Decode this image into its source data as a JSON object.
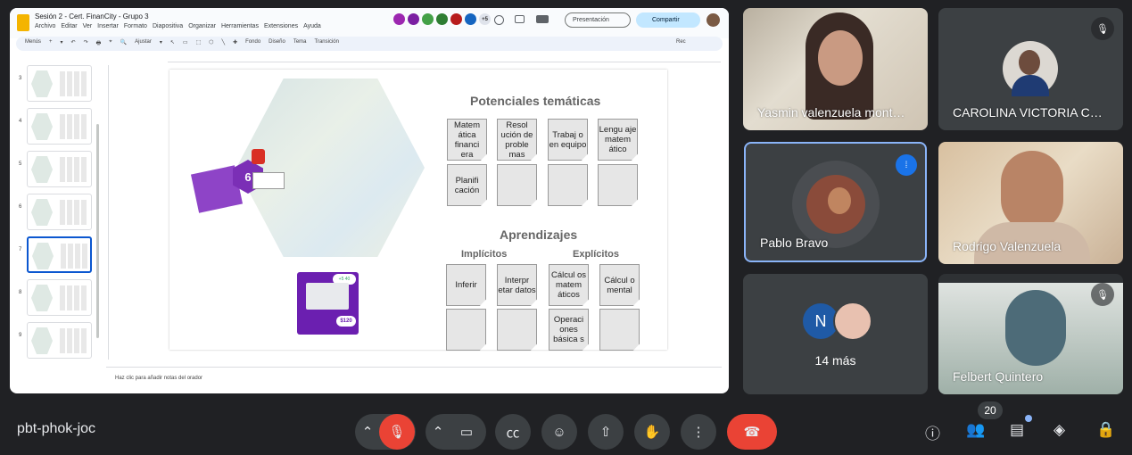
{
  "doc": {
    "title": "Sesión 2 - Cert. FinanCity - Grupo 3",
    "menu": [
      "Archivo",
      "Editar",
      "Ver",
      "Insertar",
      "Formato",
      "Diapositiva",
      "Organizar",
      "Herramientas",
      "Extensiones",
      "Ayuda"
    ],
    "collab_more": "+5",
    "present_label": "Presentación",
    "share_label": "Compartir",
    "toolbar": [
      "Menús",
      "+",
      "▾",
      "↶",
      "↷",
      "🖶",
      "⌖",
      "🔍",
      "Ajustar",
      "▾",
      "↖",
      "▭",
      "⬚",
      "⬡",
      "╲",
      "✚",
      "Fondo",
      "Diseño",
      "Tema",
      "Transición"
    ],
    "rec_label": "Rec",
    "notes_placeholder": "Haz clic para añadir notas del orador"
  },
  "thumbs": [
    "3",
    "4",
    "5",
    "6",
    "7",
    "8",
    "9"
  ],
  "slide": {
    "title1": "Potenciales temáticas",
    "row1": [
      "Matem ática financi era",
      "Resol ución de proble mas",
      "Trabaj o en equipo",
      "Lengu aje matem ático"
    ],
    "row2": [
      "Planifi cación",
      "",
      "",
      ""
    ],
    "title2": "Aprendizajes",
    "sub_left": "Implícitos",
    "sub_right": "Explícitos",
    "row3": [
      "Inferir",
      "Interpr etar datos",
      "Cálcul os matem áticos",
      "Cálcul o mental"
    ],
    "row4": [
      "",
      "",
      "Operaci ones básica s",
      ""
    ],
    "hex_number": "6",
    "card_price": "$120",
    "card_badge": "+5 40"
  },
  "tiles": {
    "t1_name": "Yasmin valenzuela mont…",
    "t2_name": "CAROLINA VICTORIA C…",
    "t3_name": "Pablo Bravo",
    "t4_name": "Rodrigo Valenzuela",
    "t5_initial": "N",
    "t5_more": "14 más",
    "t6_name": "Felbert Quintero"
  },
  "meeting": {
    "code": "pbt-phok-joc",
    "participants": "20"
  },
  "colors": {
    "end_call": "#ea4335",
    "share_btn": "#c2e7ff",
    "accent": "#8ab4f8"
  }
}
